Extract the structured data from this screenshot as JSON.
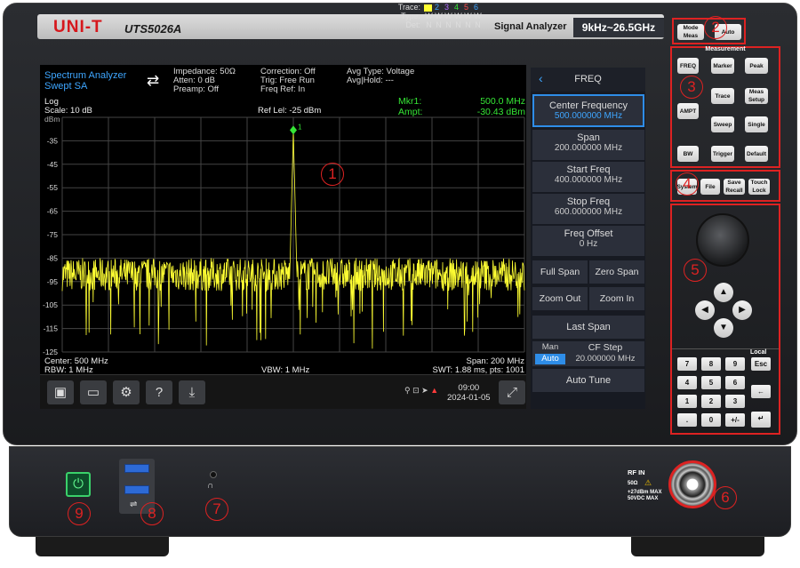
{
  "brand": {
    "logo": "UNI-T",
    "model": "UTS5026A",
    "type": "Signal Analyzer",
    "freq_range": "9kHz~26.5GHz"
  },
  "header": {
    "mode_line1": "Spectrum Analyzer",
    "mode_line2": "Swept SA",
    "impedance": "Impedance: 50Ω",
    "atten": "Atten: 0 dB",
    "preamp": "Preamp: Off",
    "correction": "Correction: Off",
    "trig": "Trig: Free Run",
    "freq_ref": "Freq Ref: In",
    "avg_type": "Avg Type: Voltage",
    "avg_hold": "Avg|Hold: ---",
    "trace_label": "Trace:",
    "type_label": "Type:",
    "det_label": "Det:",
    "trace_numbers": [
      "2",
      "3",
      "4",
      "5",
      "6"
    ],
    "type_values": [
      "W",
      "W",
      "W",
      "W",
      "W",
      "W"
    ],
    "det_values": [
      "N",
      "N",
      "N",
      "N",
      "N",
      "N"
    ]
  },
  "display": {
    "scale_type": "Log",
    "scale": "Scale: 10 dB",
    "unit": "dBm",
    "ref_level": "Ref Lel: -25 dBm",
    "marker_name": "Mkr1:",
    "marker_freq": "500.0 MHz",
    "ampt_label": "Ampt:",
    "marker_ampt": "-30.43 dBm",
    "marker_tag": "1",
    "center": "Center: 500 MHz",
    "rbw": "RBW: 1 MHz",
    "vbw": "VBW: 1 MHz",
    "span": "Span: 200 MHz",
    "swt": "SWT: 1.88 ms, pts: 1001",
    "time": "09:00",
    "date": "2024-01-05"
  },
  "chart_data": {
    "type": "line",
    "ylabels": [
      "-35",
      "-45",
      "-55",
      "-65",
      "-75",
      "-85",
      "-95",
      "-105",
      "-115",
      "-125"
    ],
    "ylim": [
      -125,
      -25
    ],
    "xlim": [
      400,
      600
    ],
    "grid": true,
    "series": [
      {
        "color": "#ffff33",
        "noise_floor_dbm": -92,
        "peak_freq_mhz": 500,
        "peak_dbm": -30.43
      }
    ]
  },
  "menu": {
    "title": "FREQ",
    "center_freq_label": "Center Frequency",
    "center_freq_value": "500.000000 MHz",
    "span_label": "Span",
    "span_value": "200.000000 MHz",
    "start_label": "Start Freq",
    "start_value": "400.000000 MHz",
    "stop_label": "Stop Freq",
    "stop_value": "600.000000 MHz",
    "offset_label": "Freq Offset",
    "offset_value": "0 Hz",
    "full_span": "Full Span",
    "zero_span": "Zero Span",
    "zoom_out": "Zoom Out",
    "zoom_in": "Zoom In",
    "last_span": "Last Span",
    "man": "Man",
    "auto": "Auto",
    "cf_step_label": "CF Step",
    "cf_step_value": "20.000000 MHz",
    "auto_tune": "Auto Tune"
  },
  "panel": {
    "mode_meas": "Mode Meas",
    "auto": "Auto",
    "measurement_title": "Measurement",
    "freq": "FREQ",
    "ampt": "AMPT",
    "bw": "BW",
    "marker": "Marker",
    "peak": "Peak",
    "trace": "Trace",
    "meas_setup": "Meas Setup",
    "sweep": "Sweep",
    "single": "Single",
    "trigger": "Trigger",
    "default": "Default",
    "system": "System",
    "file": "File",
    "save_recall": "Save Recall",
    "touch_lock": "Touch Lock",
    "local": "Local",
    "esc": "Esc",
    "keys": [
      "7",
      "8",
      "9",
      "4",
      "5",
      "6",
      "1",
      "2",
      "3",
      ".",
      "0",
      "+/-"
    ],
    "back_key": "←",
    "enter_key": "↵"
  },
  "front": {
    "rf_in": "RF IN",
    "rf_ohms": "50Ω",
    "rf_max1": "+27dBm MAX",
    "rf_max2": "50VDC MAX"
  },
  "callouts": [
    "1",
    "2",
    "3",
    "4",
    "5",
    "6",
    "7",
    "8",
    "9"
  ]
}
